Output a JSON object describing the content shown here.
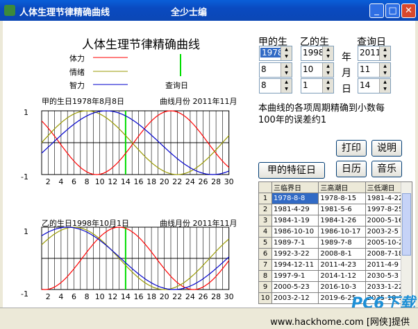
{
  "window": {
    "title": "人体生理节律精确曲线",
    "author": "全少士编"
  },
  "main_title": "人体生理节律精确曲线",
  "legend": {
    "physical": "体力",
    "emotion": "情绪",
    "intellect": "智力",
    "query_day": "查询日"
  },
  "colors": {
    "physical": "#ff0000",
    "emotion": "#999900",
    "intellect": "#0000cc",
    "query": "#00dd00"
  },
  "chart1": {
    "caption": "甲的生日1978年8月8日",
    "month_caption": "曲线月份 2011年11月"
  },
  "chart2": {
    "caption": "乙的生日1998年10月1日",
    "month_caption": "曲线月份 2011年11月"
  },
  "chart_data": [
    {
      "type": "line",
      "x": [
        1,
        2,
        3,
        4,
        5,
        6,
        7,
        8,
        9,
        10,
        11,
        12,
        13,
        14,
        15,
        16,
        17,
        18,
        19,
        20,
        21,
        22,
        23,
        24,
        25,
        26,
        27,
        28,
        29,
        30
      ],
      "ylim": [
        -1,
        1
      ],
      "query_day": 14,
      "series": [
        {
          "name": "体力",
          "period": 23,
          "peak_day": 21
        },
        {
          "name": "情绪",
          "period": 28,
          "peak_day": 8
        },
        {
          "name": "智力",
          "period": 33,
          "peak_day": 11
        }
      ]
    },
    {
      "type": "line",
      "x": [
        1,
        2,
        3,
        4,
        5,
        6,
        7,
        8,
        9,
        10,
        11,
        12,
        13,
        14,
        15,
        16,
        17,
        18,
        19,
        20,
        21,
        22,
        23,
        24,
        25,
        26,
        27,
        28,
        29,
        30
      ],
      "ylim": [
        -1,
        1
      ],
      "query_day": 14,
      "series": [
        {
          "name": "体力",
          "period": 23,
          "peak_day": 13
        },
        {
          "name": "情绪",
          "period": 28,
          "peak_day": 6
        },
        {
          "name": "智力",
          "period": 33,
          "peak_day": 5
        }
      ]
    }
  ],
  "axis": {
    "y_top": "1",
    "y_bottom": "-1",
    "ticks": [
      "2",
      "4",
      "6",
      "8",
      "10",
      "12",
      "14",
      "16",
      "18",
      "20",
      "22",
      "24",
      "26",
      "28",
      "30"
    ]
  },
  "inputs": {
    "col_a_label": "甲的生",
    "col_b_label": "乙的生",
    "col_q_label": "查询日",
    "unit_year": "年",
    "unit_month": "月",
    "unit_day": "日",
    "a": [
      "1978",
      "8",
      "8"
    ],
    "b": [
      "1998",
      "10",
      "1"
    ],
    "q": [
      "2011",
      "11",
      "14"
    ]
  },
  "note": "本曲线的各项周期精确到小数每100年的误差约1",
  "buttons": {
    "print": "打印",
    "about": "说明",
    "features": "甲的特征日",
    "calendar": "日历",
    "music": "音乐"
  },
  "table": {
    "headers": [
      "",
      "三临界日",
      "三高潮日",
      "三低潮日"
    ],
    "rows": [
      [
        "1",
        "1978-8-8",
        "1978-8-15",
        "1981-4-22"
      ],
      [
        "2",
        "1981-4-29",
        "1981-5-6",
        "1997-8-25"
      ],
      [
        "3",
        "1984-1-19",
        "1984-1-26",
        "2000-5-16"
      ],
      [
        "4",
        "1986-10-10",
        "1986-10-17",
        "2003-2-5"
      ],
      [
        "5",
        "1989-7-1",
        "1989-7-8",
        "2005-10-27"
      ],
      [
        "6",
        "1992-3-22",
        "2008-8-1",
        "2008-7-18"
      ],
      [
        "7",
        "1994-12-11",
        "2011-4-23",
        "2011-4-9"
      ],
      [
        "8",
        "1997-9-1",
        "2014-1-12",
        "2030-5-3"
      ],
      [
        "9",
        "2000-5-23",
        "2016-10-3",
        "2033-1-22"
      ],
      [
        "10",
        "2003-2-12",
        "2019-6-25",
        "2035-10-14"
      ]
    ]
  },
  "watermark": "PC6下载",
  "status": "www.hackhome.com [网侠]提供"
}
